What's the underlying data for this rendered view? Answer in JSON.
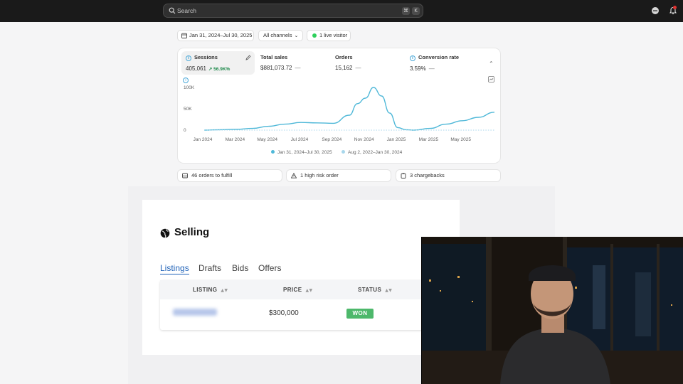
{
  "topbar": {
    "search_placeholder": "Search",
    "shortcut_keys": [
      "⌘",
      "K"
    ],
    "icons": [
      "store-icon",
      "bell-icon"
    ]
  },
  "filters": {
    "date_range": "Jan 31, 2024–Jul 30, 2025",
    "channels": "All channels",
    "live_visitors": "1 live visitor"
  },
  "metrics": [
    {
      "label": "Sessions",
      "value": "405,061",
      "change": "↗ 56.9K%"
    },
    {
      "label": "Total sales",
      "value": "$881,073.72",
      "change": "—"
    },
    {
      "label": "Orders",
      "value": "15,162",
      "change": "—"
    },
    {
      "label": "Conversion rate",
      "value": "3.59%",
      "change": "—"
    }
  ],
  "chart_data": {
    "type": "line",
    "y_tick_labels": [
      "100K",
      "50K",
      "0"
    ],
    "x_tick_labels": [
      "Jan 2024",
      "Mar 2024",
      "May 2024",
      "Jul 2024",
      "Sep 2024",
      "Nov 2024",
      "Jan 2025",
      "Mar 2025",
      "May 2025"
    ],
    "ylim": [
      0,
      100000
    ],
    "x_index_range": [
      0,
      18
    ],
    "grid": false,
    "legend_position": "bottom",
    "series": [
      {
        "name": "Jan 31, 2024–Jul 30, 2025",
        "color": "#4fb8d8",
        "style": "solid",
        "x": [
          0,
          1,
          2,
          3,
          4,
          5,
          6,
          7,
          8,
          9,
          9.5,
          10,
          10.5,
          11,
          11.5,
          12,
          12.5,
          13,
          14,
          15,
          16,
          17,
          18
        ],
        "y": [
          0,
          1000,
          2000,
          4000,
          9000,
          14000,
          18000,
          17000,
          16000,
          35000,
          62000,
          75000,
          100000,
          80000,
          40000,
          6000,
          1000,
          0,
          4000,
          14000,
          22000,
          30000,
          42000
        ]
      },
      {
        "name": "Aug 2, 2022–Jan 30, 2024",
        "color": "#a8d7ec",
        "style": "dotted",
        "x": [
          0,
          18
        ],
        "y": [
          0,
          0
        ]
      }
    ]
  },
  "alerts": [
    "46 orders to fulfill",
    "1 high risk order",
    "3 chargebacks"
  ],
  "selling": {
    "title": "Selling",
    "tabs": [
      "Listings",
      "Drafts",
      "Bids",
      "Offers"
    ],
    "active_tab": "Listings",
    "columns": [
      "LISTING",
      "PRICE",
      "STATUS"
    ],
    "rows": [
      {
        "price": "$300,000",
        "status": "WON"
      }
    ],
    "status_color": "#4db86b"
  },
  "colors": {
    "accent_blue": "#1f62b8",
    "line": "#4fb8d8",
    "positive": "#1f8a4c"
  }
}
